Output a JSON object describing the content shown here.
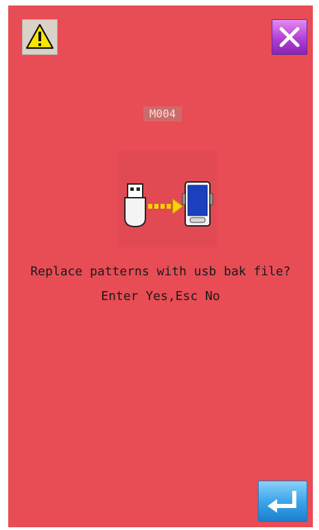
{
  "dialog": {
    "message_code": "M004",
    "message_line1": "Replace patterns with usb bak file?",
    "message_line2": "Enter Yes,Esc No"
  },
  "icons": {
    "warning": "warning-icon",
    "close": "close-icon",
    "usb": "usb-drive-icon",
    "arrow": "transfer-arrow-icon",
    "device": "device-icon",
    "enter": "enter-icon"
  },
  "colors": {
    "background": "#e84c55",
    "close_button": "#b13fd6",
    "enter_button": "#3ea6ea",
    "warning_yellow": "#f6e600"
  }
}
